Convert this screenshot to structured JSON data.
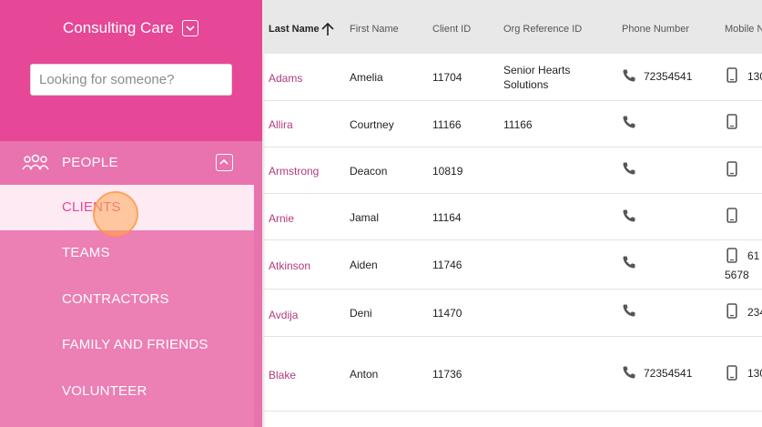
{
  "sidebar": {
    "org_name": "Consulting Care",
    "search_placeholder": "Looking for someone?",
    "section_label": "PEOPLE",
    "items": [
      {
        "label": "CLIENTS",
        "active": true
      },
      {
        "label": "TEAMS"
      },
      {
        "label": "CONTRACTORS"
      },
      {
        "label": "FAMILY AND FRIENDS"
      },
      {
        "label": "VOLUNTEER"
      }
    ]
  },
  "table": {
    "columns": [
      "Last Name",
      "First Name",
      "Client ID",
      "Org Reference ID",
      "Phone Number",
      "Mobile N"
    ],
    "rows": [
      {
        "last": "Adams",
        "first": "Amelia",
        "id": "11704",
        "org": "Senior Hearts Solutions",
        "phone": "72354541",
        "mobile": "130"
      },
      {
        "last": "Allira",
        "first": "Courtney",
        "id": "11166",
        "org": "11166",
        "phone": "",
        "mobile": ""
      },
      {
        "last": "Armstrong",
        "first": "Deacon",
        "id": "10819",
        "org": "",
        "phone": "",
        "mobile": ""
      },
      {
        "last": "Arnie",
        "first": "Jamal",
        "id": "11164",
        "org": "",
        "phone": "",
        "mobile": ""
      },
      {
        "last": "Atkinson",
        "first": "Aiden",
        "id": "11746",
        "org": "",
        "phone": "",
        "mobile": "61",
        "mobile2": "5678"
      },
      {
        "last": "Avdija",
        "first": "Deni",
        "id": "11470",
        "org": "",
        "phone": "",
        "mobile": "234"
      },
      {
        "last": "Blake",
        "first": "Anton",
        "id": "11736",
        "org": "",
        "phone": "72354541",
        "mobile": "130"
      }
    ]
  },
  "colors": {
    "header_pink": "#e64796",
    "sidebar_pink": "#ec7fb4",
    "link": "#b23a7d"
  }
}
